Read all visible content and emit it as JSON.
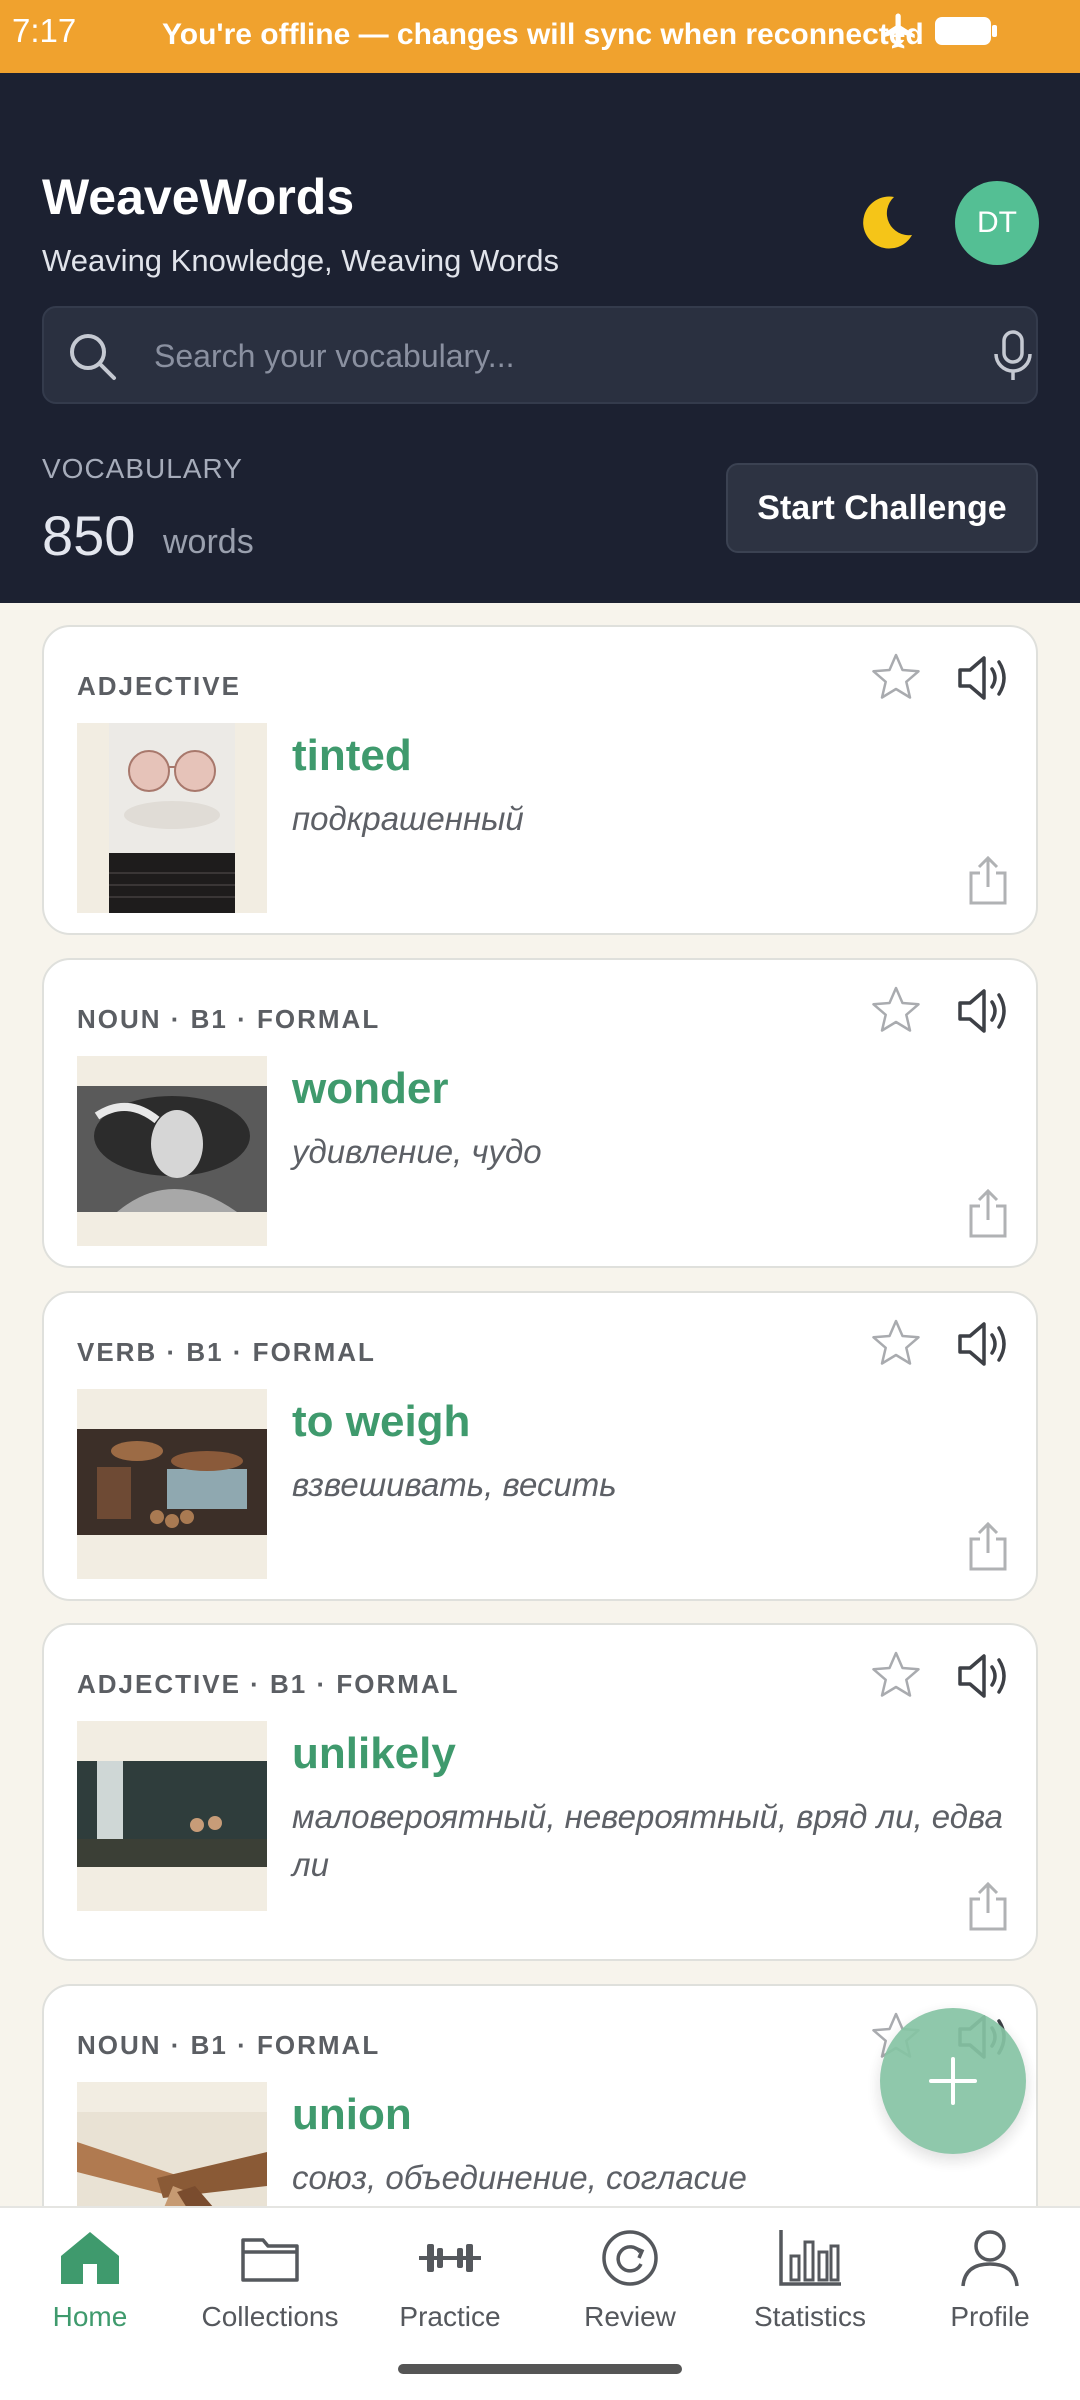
{
  "status_bar": {
    "time": "7:17",
    "offline_message": "You're offline — changes will sync when reconnected"
  },
  "header": {
    "title": "WeaveWords",
    "subtitle": "Weaving Knowledge, Weaving Words",
    "avatar_initials": "DT",
    "theme_icon": "moon-icon"
  },
  "search": {
    "placeholder": "Search your vocabulary..."
  },
  "vocabulary": {
    "label": "VOCABULARY",
    "count": "850",
    "unit": "words",
    "challenge_label": "Start Challenge"
  },
  "cards": [
    {
      "pos": "ADJECTIVE",
      "word": "tinted",
      "translation": "подкрашенный",
      "image": "sunglasses-photo"
    },
    {
      "pos": "NOUN · B1 · FORMAL",
      "word": "wonder",
      "translation": "удивление, чудо",
      "image": "woman-portrait-photo"
    },
    {
      "pos": "VERB · B1 · FORMAL",
      "word": "to weigh",
      "translation": "взвешивать, весить",
      "image": "scales-photo"
    },
    {
      "pos": "ADJECTIVE · B1 · FORMAL",
      "word": "unlikely",
      "translation": "маловероятный, невероятный, вряд ли, едва ли",
      "image": "waterfall-photo"
    },
    {
      "pos": "NOUN · B1 · FORMAL",
      "word": "union",
      "translation": "союз, объединение, согласие",
      "image": "hands-together-photo"
    }
  ],
  "nav": [
    {
      "label": "Home",
      "icon": "home-icon",
      "active": true
    },
    {
      "label": "Collections",
      "icon": "folder-icon",
      "active": false
    },
    {
      "label": "Practice",
      "icon": "dumbbell-icon",
      "active": false
    },
    {
      "label": "Review",
      "icon": "refresh-icon",
      "active": false
    },
    {
      "label": "Statistics",
      "icon": "bar-chart-icon",
      "active": false
    },
    {
      "label": "Profile",
      "icon": "user-icon",
      "active": false
    }
  ],
  "colors": {
    "offline_banner": "#f0a22e",
    "header_bg": "#1c2131",
    "accent_green": "#3f9a6d",
    "avatar_bg": "#54bf94"
  }
}
